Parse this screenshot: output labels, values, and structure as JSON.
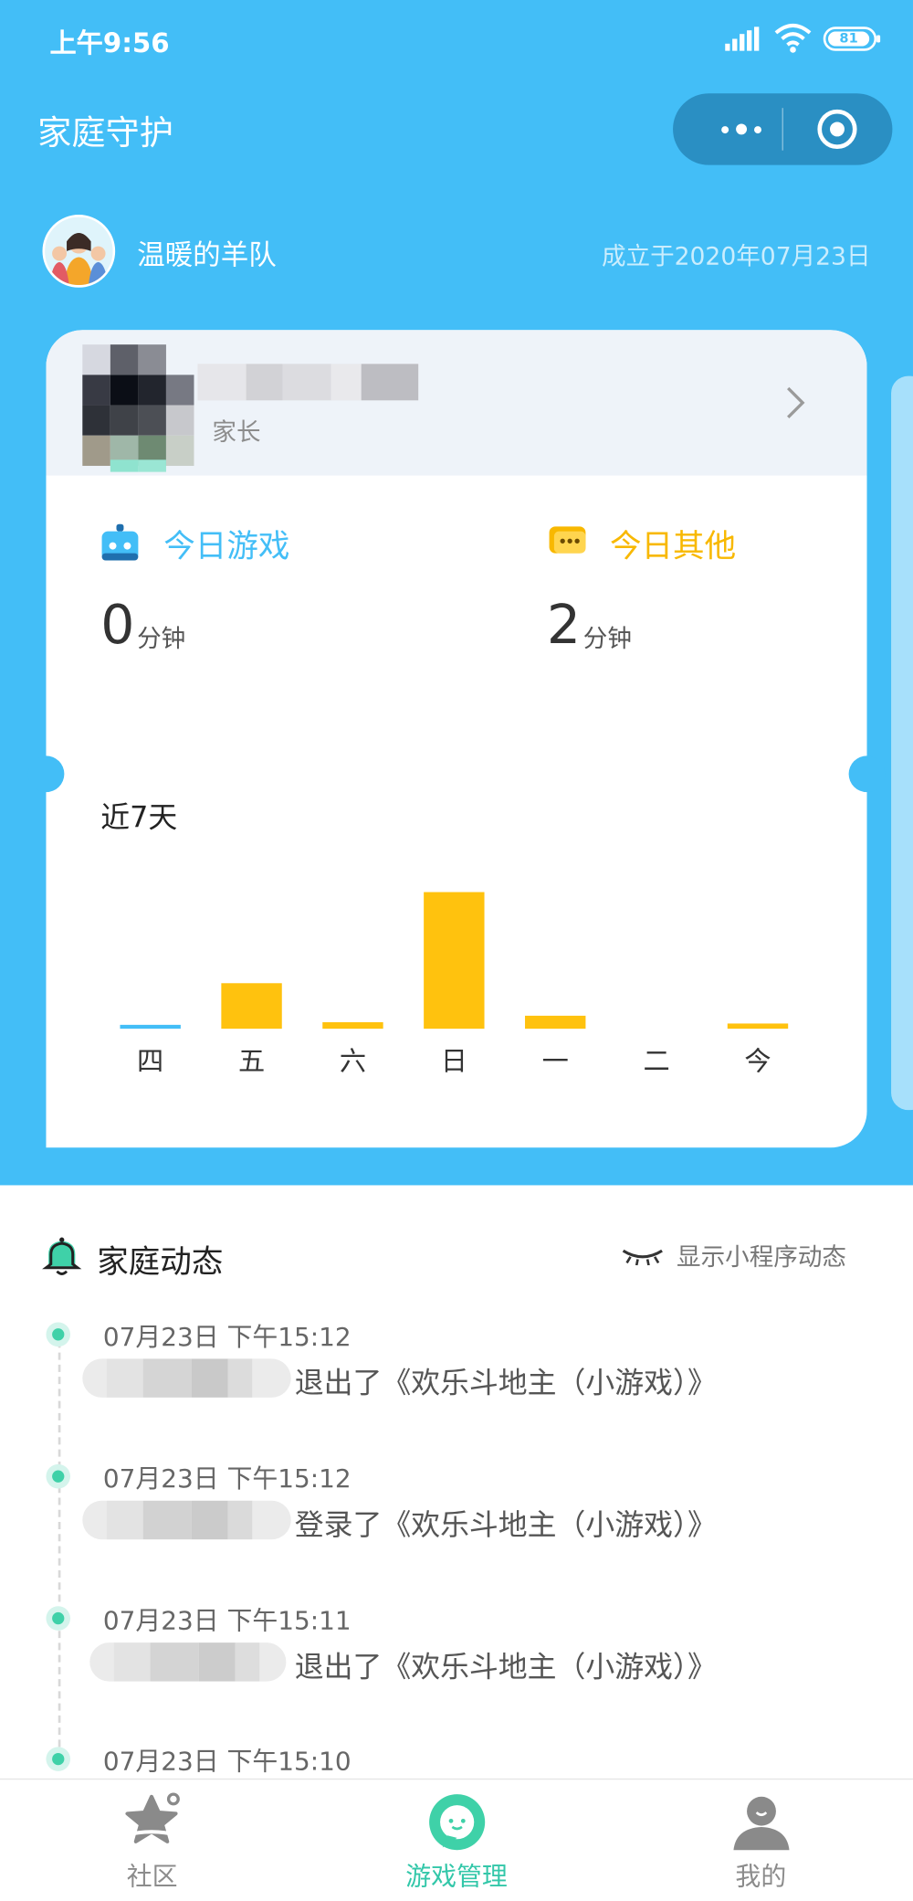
{
  "status_bar": {
    "time": "上午9:56",
    "battery": "81"
  },
  "header": {
    "title": "家庭守护"
  },
  "team": {
    "name": "温暖的羊队",
    "founded": "成立于2020年07月23日"
  },
  "member": {
    "role": "家长"
  },
  "today": {
    "game": {
      "label": "今日游戏",
      "value": "0",
      "unit": "分钟",
      "color": "#43bef7"
    },
    "other": {
      "label": "今日其他",
      "value": "2",
      "unit": "分钟",
      "color": "#f8b800"
    }
  },
  "week": {
    "title": "近7天"
  },
  "chart_data": {
    "type": "bar",
    "categories": [
      "四",
      "五",
      "六",
      "日",
      "一",
      "二",
      "今"
    ],
    "series": [
      {
        "values": [
          0.3,
          3.5,
          0.5,
          10.5,
          1.0,
          0,
          0.4
        ],
        "colors": [
          "#43bef7",
          "#ffc20e",
          "#ffc20e",
          "#ffc20e",
          "#ffc20e",
          "#ffc20e",
          "#ffc20e"
        ]
      }
    ],
    "ylim": [
      0,
      11
    ]
  },
  "feed": {
    "title": "家庭动态",
    "toggle_label": "显示小程序动态",
    "items": [
      {
        "time": "07月23日 下午15:12",
        "text": "退出了《欢乐斗地主（小游戏）》"
      },
      {
        "time": "07月23日 下午15:12",
        "text": "登录了《欢乐斗地主（小游戏）》"
      },
      {
        "time": "07月23日 下午15:11",
        "text": "退出了《欢乐斗地主（小游戏）》"
      },
      {
        "time": "07月23日 下午15:10",
        "text": ""
      }
    ]
  },
  "tabbar": {
    "community": "社区",
    "games": "游戏管理",
    "mine": "我的"
  }
}
